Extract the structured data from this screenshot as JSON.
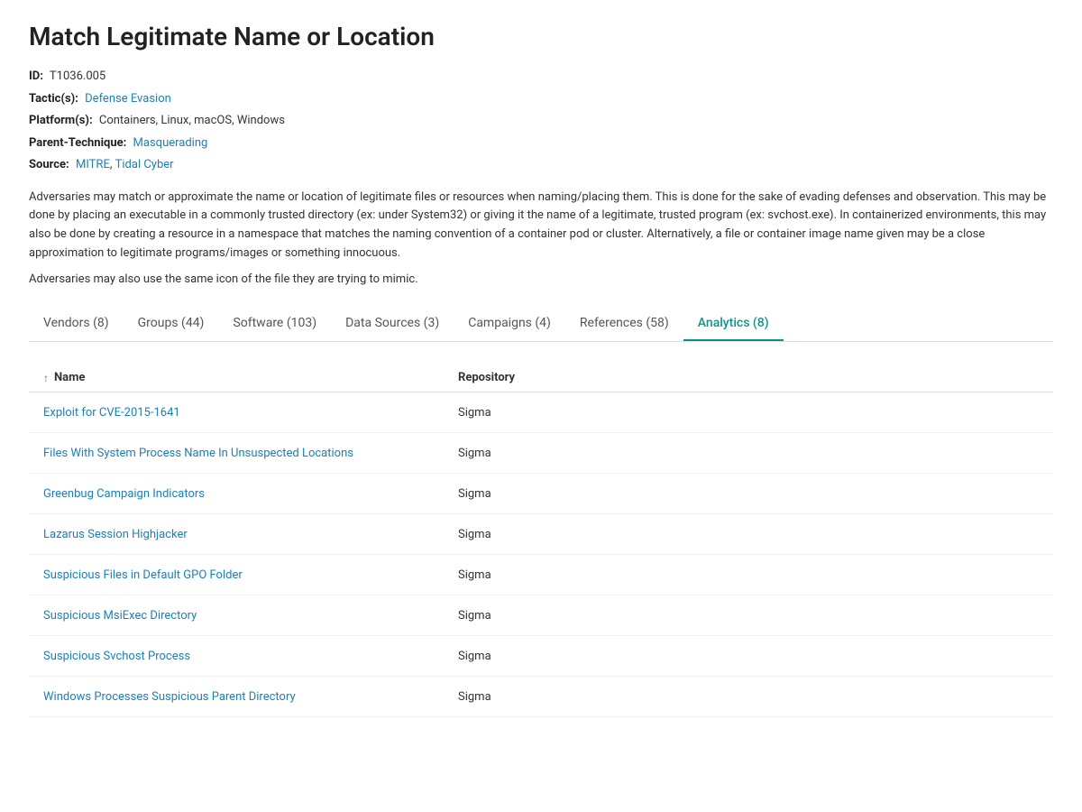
{
  "page": {
    "title": "Match Legitimate Name or Location",
    "id": "T1036.005",
    "tactics_label": "Tactic(s):",
    "tactics": [
      {
        "label": "Defense Evasion",
        "href": "#"
      }
    ],
    "platforms_label": "Platform(s):",
    "platforms": "Containers, Linux, macOS, Windows",
    "parent_technique_label": "Parent-Technique:",
    "parent_technique": {
      "label": "Masquerading",
      "href": "#"
    },
    "source_label": "Source:",
    "sources": [
      {
        "label": "MITRE",
        "href": "#"
      },
      {
        "label": "Tidal Cyber",
        "href": "#"
      }
    ],
    "description_para1": "Adversaries may match or approximate the name or location of legitimate files or resources when naming/placing them. This is done for the sake of evading defenses and observation. This may be done by placing an executable in a commonly trusted directory (ex: under System32) or giving it the name of a legitimate, trusted program (ex: svchost.exe). In containerized environments, this may also be done by creating a resource in a namespace that matches the naming convention of a container pod or cluster. Alternatively, a file or container image name given may be a close approximation to legitimate programs/images or something innocuous.",
    "description_para2": "Adversaries may also use the same icon of the file they are trying to mimic."
  },
  "tabs": [
    {
      "id": "vendors",
      "label": "Vendors (8)",
      "active": false
    },
    {
      "id": "groups",
      "label": "Groups (44)",
      "active": false
    },
    {
      "id": "software",
      "label": "Software (103)",
      "active": false
    },
    {
      "id": "data-sources",
      "label": "Data Sources (3)",
      "active": false
    },
    {
      "id": "campaigns",
      "label": "Campaigns (4)",
      "active": false
    },
    {
      "id": "references",
      "label": "References (58)",
      "active": false
    },
    {
      "id": "analytics",
      "label": "Analytics (8)",
      "active": true
    }
  ],
  "table": {
    "col_name": "Name",
    "col_repo": "Repository",
    "sort_icon": "↑",
    "rows": [
      {
        "name": "Exploit for CVE-2015-1641",
        "repo": "Sigma"
      },
      {
        "name": "Files With System Process Name In Unsuspected Locations",
        "repo": "Sigma"
      },
      {
        "name": "Greenbug Campaign Indicators",
        "repo": "Sigma"
      },
      {
        "name": "Lazarus Session Highjacker",
        "repo": "Sigma"
      },
      {
        "name": "Suspicious Files in Default GPO Folder",
        "repo": "Sigma"
      },
      {
        "name": "Suspicious MsiExec Directory",
        "repo": "Sigma"
      },
      {
        "name": "Suspicious Svchost Process",
        "repo": "Sigma"
      },
      {
        "name": "Windows Processes Suspicious Parent Directory",
        "repo": "Sigma"
      }
    ]
  }
}
